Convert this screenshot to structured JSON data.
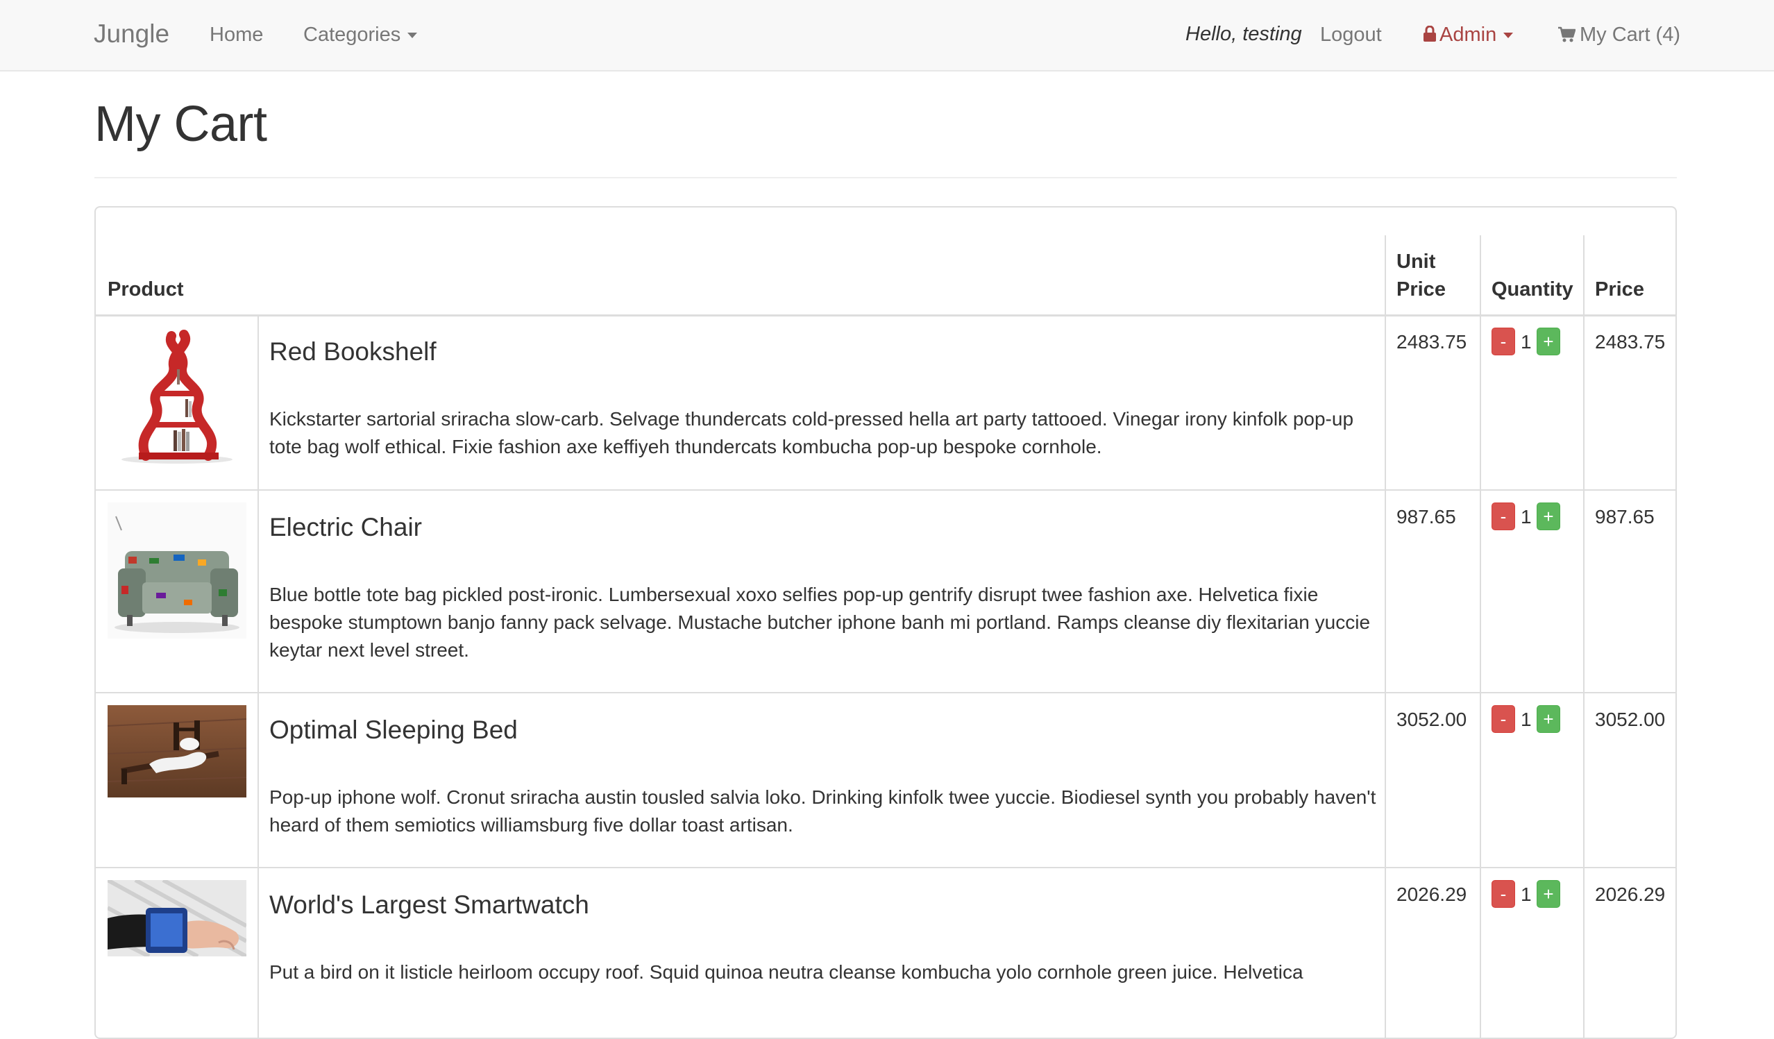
{
  "navbar": {
    "brand": "Jungle",
    "home": "Home",
    "categories": "Categories",
    "greeting": "Hello, testing",
    "logout": "Logout",
    "admin": "Admin",
    "cart": "My Cart (4)"
  },
  "page": {
    "title": "My Cart"
  },
  "table": {
    "headers": {
      "product": "Product",
      "unit_price_1": "Unit",
      "unit_price_2": "Price",
      "quantity": "Quantity",
      "price": "Price"
    },
    "rows": [
      {
        "name": "Red Bookshelf",
        "description": "Kickstarter sartorial sriracha slow-carb. Selvage thundercats cold-pressed hella art party tattooed. Vinegar irony kinfolk pop-up tote bag wolf ethical. Fixie fashion axe keffiyeh thundercats kombucha pop-up bespoke cornhole.",
        "unit_price": "2483.75",
        "quantity": "1",
        "price": "2483.75",
        "minus": "-",
        "plus": "+"
      },
      {
        "name": "Electric Chair",
        "description": "Blue bottle tote bag pickled post-ironic. Lumbersexual xoxo selfies pop-up gentrify disrupt twee fashion axe. Helvetica fixie bespoke stumptown banjo fanny pack selvage. Mustache butcher iphone banh mi portland. Ramps cleanse diy flexitarian yuccie keytar next level street.",
        "unit_price": "987.65",
        "quantity": "1",
        "price": "987.65",
        "minus": "-",
        "plus": "+"
      },
      {
        "name": "Optimal Sleeping Bed",
        "description": "Pop-up iphone wolf. Cronut sriracha austin tousled salvia loko. Drinking kinfolk twee yuccie. Biodiesel synth you probably haven't heard of them semiotics williamsburg five dollar toast artisan.",
        "unit_price": "3052.00",
        "quantity": "1",
        "price": "3052.00",
        "minus": "-",
        "plus": "+"
      },
      {
        "name": "World's Largest Smartwatch",
        "description": "Put a bird on it listicle heirloom occupy roof. Squid quinoa neutra cleanse kombucha yolo cornhole green juice. Helvetica",
        "unit_price": "2026.29",
        "quantity": "1",
        "price": "2026.29",
        "minus": "-",
        "plus": "+"
      }
    ]
  }
}
